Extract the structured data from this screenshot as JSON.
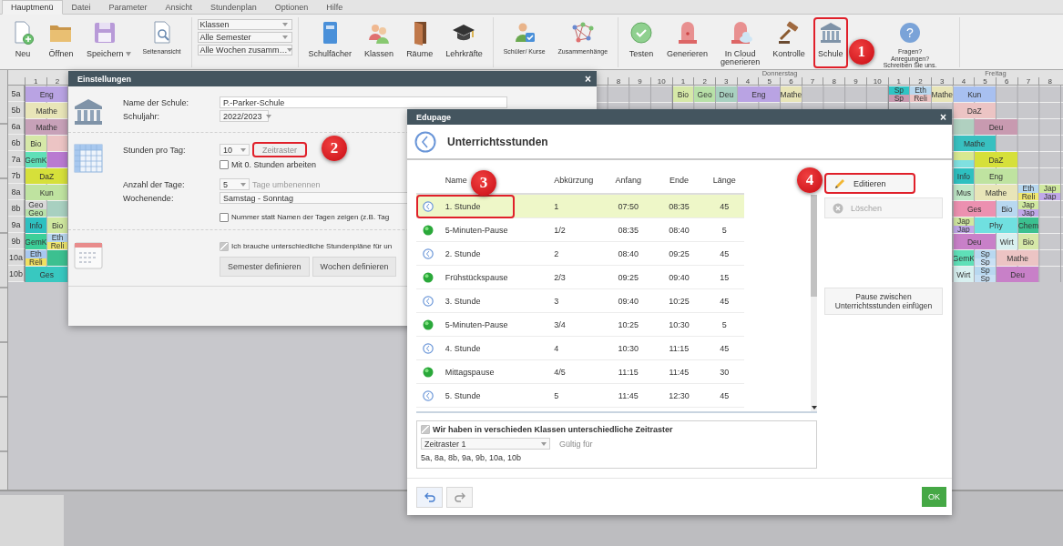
{
  "menu": {
    "tabs": [
      {
        "label": "Hauptmenü",
        "selected": true
      },
      {
        "label": "Datei",
        "selected": false
      },
      {
        "label": "Parameter",
        "selected": false
      },
      {
        "label": "Ansicht",
        "selected": false
      },
      {
        "label": "Stundenplan",
        "selected": false
      },
      {
        "label": "Optionen",
        "selected": false
      },
      {
        "label": "Hilfe",
        "selected": false
      }
    ]
  },
  "toolbar": {
    "groups": [
      {
        "kind": "tools",
        "items": [
          {
            "label": "Neu"
          },
          {
            "label": "Öffnen"
          },
          {
            "label": "Speichern",
            "dropdown": true
          },
          {
            "label": "Seitenansicht",
            "small": true
          }
        ]
      },
      {
        "kind": "selects",
        "items": [
          {
            "value": "Klassen"
          },
          {
            "value": "Alle Semester"
          },
          {
            "value": "Alle Wochen zusamm…"
          }
        ]
      },
      {
        "kind": "tools",
        "items": [
          {
            "label": "Schulfächer"
          },
          {
            "label": "Klassen"
          },
          {
            "label": "Räume"
          },
          {
            "label": "Lehrkräfte"
          }
        ]
      },
      {
        "kind": "tools",
        "items": [
          {
            "label": "Schüler/ Kurse",
            "small": true
          },
          {
            "label": "Zusammenhänge",
            "small": true
          }
        ]
      },
      {
        "kind": "tools",
        "items": [
          {
            "label": "Testen"
          },
          {
            "label": "Generieren"
          },
          {
            "lines": [
              "In Cloud",
              "generieren"
            ]
          },
          {
            "label": "Kontrolle"
          },
          {
            "label": "Schule",
            "marker": "1"
          },
          {
            "glyph": "?",
            "lines": [
              "Fragen?",
              "Anregungen?",
              "Schreiben Sie uns."
            ],
            "small": true
          }
        ]
      }
    ]
  },
  "timetable": {
    "thursday_name": "Donnerstag",
    "friday_name": "Freitag",
    "monday_numbers": [
      "1",
      "2"
    ],
    "wednesday_numbers": [
      "8",
      "9",
      "10"
    ],
    "thursday_numbers": [
      "1",
      "2",
      "3",
      "4",
      "5",
      "6",
      "7",
      "8",
      "9",
      "10"
    ],
    "friday_numbers": [
      "1",
      "2",
      "3",
      "4",
      "5",
      "6",
      "7",
      "8"
    ],
    "rows": [
      {
        "class": "5a",
        "monday": [
          {
            "kind": "double",
            "parts": [
              {
                "label": "Eng",
                "color": "#b9a3e3"
              }
            ]
          }
        ],
        "thursday": [
          {
            "kind": "single",
            "parts": [
              {
                "label": "Bio",
                "color": "#d6e8a8"
              }
            ]
          },
          {
            "kind": "single",
            "parts": [
              {
                "label": "Geo",
                "color": "#b8e0a8"
              }
            ]
          },
          {
            "kind": "single",
            "parts": [
              {
                "label": "Deu",
                "color": "#a8d0c0"
              }
            ]
          },
          {
            "kind": "double",
            "parts": [
              {
                "label": "Eng",
                "color": "#b9a3e3"
              }
            ]
          },
          {
            "kind": "single",
            "parts": [
              {
                "label": "Mathe",
                "color": "#e8e5b8"
              }
            ]
          }
        ],
        "friday": [
          {
            "kind": "single",
            "parts": [
              {
                "label": "Sp",
                "color": "#2ec4c4"
              },
              {
                "label": "Sp",
                "color": "#c89ab0"
              }
            ]
          },
          {
            "kind": "single",
            "parts": [
              {
                "label": "Eth",
                "color": "#b8d8f0"
              },
              {
                "label": "Reli",
                "color": "#ecc4c4"
              }
            ]
          },
          {
            "kind": "single",
            "parts": [
              {
                "label": "Mathe",
                "color": "#e8e5b8"
              }
            ]
          },
          {
            "kind": "double",
            "parts": [
              {
                "label": "Kun",
                "color": "#a8c0f0"
              }
            ]
          }
        ]
      },
      {
        "class": "5b",
        "monday": [
          {
            "kind": "double",
            "parts": [
              {
                "label": "Mathe",
                "color": "#e8e5b8"
              }
            ]
          }
        ],
        "friday_end": [
          {
            "kind": "double",
            "parts": [
              {
                "label": "DaZ",
                "color": "#ecc4c4"
              }
            ]
          }
        ]
      },
      {
        "class": "6a",
        "monday": [
          {
            "kind": "double",
            "parts": [
              {
                "label": "Mathe",
                "color": "#c7a1b8"
              }
            ]
          }
        ],
        "friday_end": [
          {
            "kind": "single",
            "parts": [
              {
                "color": "#b0d0c0"
              }
            ]
          },
          {
            "kind": "double",
            "parts": [
              {
                "label": "Deu",
                "color": "#c89ab0"
              }
            ]
          }
        ]
      },
      {
        "class": "6b",
        "monday": [
          {
            "kind": "single",
            "parts": [
              {
                "label": "Bio",
                "color": "#d6e8a8"
              }
            ]
          },
          {
            "kind": "single",
            "parts": [
              {
                "color": "#ecc4c4"
              }
            ]
          }
        ],
        "friday_end": [
          {
            "kind": "double",
            "parts": [
              {
                "label": "Mathe",
                "color": "#38c0c0"
              }
            ]
          }
        ]
      },
      {
        "class": "7a",
        "monday": [
          {
            "kind": "single",
            "parts": [
              {
                "label": "GemK",
                "color": "#5fe0b8"
              }
            ]
          },
          {
            "kind": "single",
            "parts": [
              {
                "color": "#b97ad1"
              }
            ]
          }
        ],
        "friday_end": [
          {
            "kind": "single",
            "parts": [
              {
                "color": "#d8e890"
              },
              {
                "color": "#80e0e0"
              }
            ]
          },
          {
            "kind": "double",
            "parts": [
              {
                "label": "DaZ",
                "color": "#d6e03a"
              }
            ]
          }
        ]
      },
      {
        "class": "7b",
        "monday": [
          {
            "kind": "double",
            "parts": [
              {
                "label": "DaZ",
                "color": "#d6e03a"
              }
            ]
          }
        ],
        "friday_end": [
          {
            "kind": "single",
            "parts": [
              {
                "label": "Info",
                "color": "#2ec0c0"
              }
            ]
          },
          {
            "kind": "double",
            "parts": [
              {
                "label": "Eng",
                "color": "#bfe3a0"
              }
            ]
          }
        ]
      },
      {
        "class": "8a",
        "monday": [
          {
            "kind": "double",
            "parts": [
              {
                "label": "Kun",
                "color": "#bfe3a0"
              }
            ]
          }
        ],
        "friday_end": [
          {
            "kind": "single",
            "parts": [
              {
                "label": "Mus",
                "color": "#c0e8c8"
              }
            ]
          },
          {
            "kind": "double",
            "parts": [
              {
                "label": "Mathe",
                "color": "#e8e5b8"
              }
            ]
          },
          {
            "kind": "single",
            "parts": [
              {
                "label": "Eth",
                "color": "#b8d8f0"
              },
              {
                "label": "Reli",
                "color": "#f0e870"
              }
            ]
          },
          {
            "kind": "single",
            "parts": [
              {
                "label": "Jap",
                "color": "#d0e8a0"
              },
              {
                "label": "Jap",
                "color": "#c0a8e8"
              }
            ]
          }
        ]
      },
      {
        "class": "8b",
        "monday": [
          {
            "kind": "single",
            "parts": [
              {
                "label": "Geo",
                "color": "#d8d8d8"
              },
              {
                "label": "Geo",
                "color": "#b8e0a8"
              }
            ]
          },
          {
            "kind": "single",
            "parts": [
              {
                "color": "#a8d0c0"
              }
            ]
          }
        ],
        "friday_end": [
          {
            "kind": "double",
            "parts": [
              {
                "label": "Ges",
                "color": "#ec90b0"
              }
            ]
          },
          {
            "kind": "single",
            "parts": [
              {
                "label": "Bio",
                "color": "#b8d8f0"
              }
            ]
          },
          {
            "kind": "single",
            "parts": [
              {
                "label": "Jap",
                "color": "#d0e8a0"
              },
              {
                "label": "Jap",
                "color": "#c0a8e8"
              }
            ]
          }
        ]
      },
      {
        "class": "9a",
        "monday": [
          {
            "kind": "single",
            "parts": [
              {
                "label": "Info",
                "color": "#2ec0c0"
              }
            ]
          },
          {
            "kind": "single",
            "parts": [
              {
                "label": "Bio",
                "color": "#d0e8a0"
              }
            ]
          }
        ],
        "friday_end": [
          {
            "kind": "single",
            "parts": [
              {
                "label": "Jap",
                "color": "#d0e8a0"
              },
              {
                "label": "Jap",
                "color": "#c0a8e8"
              }
            ]
          },
          {
            "kind": "double",
            "parts": [
              {
                "label": "Phy",
                "color": "#70e0e0"
              }
            ]
          },
          {
            "kind": "single",
            "parts": [
              {
                "label": "Chem",
                "color": "#3cc090"
              }
            ]
          }
        ]
      },
      {
        "class": "9b",
        "monday": [
          {
            "kind": "single",
            "parts": [
              {
                "label": "GemK",
                "color": "#3ccf98"
              }
            ]
          },
          {
            "kind": "single",
            "parts": [
              {
                "label": "Eth",
                "color": "#b8d8f0"
              },
              {
                "label": "Reli",
                "color": "#f0e870"
              }
            ]
          }
        ],
        "friday_end": [
          {
            "kind": "double",
            "parts": [
              {
                "label": "Deu",
                "color": "#c880c8"
              }
            ]
          },
          {
            "kind": "single",
            "parts": [
              {
                "label": "Wirt",
                "color": "#d8f0f0"
              }
            ]
          },
          {
            "kind": "single",
            "parts": [
              {
                "label": "Bio",
                "color": "#d6e8a8"
              }
            ]
          }
        ]
      },
      {
        "class": "10a",
        "monday": [
          {
            "kind": "single",
            "parts": [
              {
                "label": "Eth",
                "color": "#a8c8f0"
              },
              {
                "label": "Reli",
                "color": "#f0e060"
              }
            ]
          },
          {
            "kind": "single",
            "parts": [
              {
                "color": "#3cc090"
              }
            ]
          }
        ],
        "friday_end": [
          {
            "kind": "single",
            "parts": [
              {
                "label": "GemK",
                "color": "#5fe0b8"
              }
            ]
          },
          {
            "kind": "single",
            "parts": [
              {
                "label": "Sp",
                "color": "#b8d8f0"
              },
              {
                "label": "Sp",
                "color": "#c8e0f4"
              }
            ]
          },
          {
            "kind": "double",
            "parts": [
              {
                "label": "Mathe",
                "color": "#ecc4c4"
              }
            ]
          }
        ]
      },
      {
        "class": "10b",
        "monday": [
          {
            "kind": "double",
            "parts": [
              {
                "label": "Ges",
                "color": "#38c8c0"
              }
            ]
          }
        ],
        "friday_end": [
          {
            "kind": "single",
            "parts": [
              {
                "label": "Wirt",
                "color": "#d8f0f0"
              }
            ]
          },
          {
            "kind": "single",
            "parts": [
              {
                "label": "Sp",
                "color": "#b8d8f0"
              },
              {
                "label": "Sp",
                "color": "#c8e0f4"
              }
            ]
          },
          {
            "kind": "double",
            "parts": [
              {
                "label": "Deu",
                "color": "#c880c8"
              }
            ]
          }
        ]
      }
    ]
  },
  "settings_dialog": {
    "title": "Einstellungen",
    "close": "×",
    "school": {
      "name_label": "Name der Schule:",
      "name": "P.-Parker-Schule",
      "year_label": "Schuljahr:",
      "year": "2022/2023"
    },
    "periods": {
      "label": "Stunden pro Tag:",
      "value": "10",
      "button": {
        "label": "Zeitraster",
        "marker": "2"
      },
      "zero_checkbox": {
        "label": "Mit 0. Stunden arbeiten",
        "checked": false
      }
    },
    "days": {
      "label": "Anzahl der Tage:",
      "value": "5",
      "rename_link": "Tage umbenennen",
      "weekend_label": "Wochenende:",
      "weekend": "Samstag - Sonntag",
      "number_checkbox": {
        "label": "Nummer statt Namen der Tagen zeigen (z.B. Tag",
        "checked": false
      }
    },
    "terms": {
      "checkbox": {
        "label": "Ich brauche unterschiedliche Stundenpläne für un",
        "checked": true
      },
      "buttons": [
        "Semester definieren",
        "Wochen definieren"
      ]
    }
  },
  "lessons_dialog": {
    "title": "Edupage",
    "close": "×",
    "heading": "Unterrichtsstunden",
    "columns": [
      "Name",
      "Abkürzung",
      "Anfang",
      "Ende",
      "Länge"
    ],
    "rows": [
      {
        "kind": "lesson",
        "name": "1. Stunde",
        "abbr": "1",
        "start": "07:50",
        "end": "08:35",
        "length": "45",
        "selected": true,
        "marker": "3"
      },
      {
        "kind": "break",
        "name": "5-Minuten-Pause",
        "abbr": "1/2",
        "start": "08:35",
        "end": "08:40",
        "length": "5",
        "selected": false
      },
      {
        "kind": "lesson",
        "name": "2. Stunde",
        "abbr": "2",
        "start": "08:40",
        "end": "09:25",
        "length": "45",
        "selected": false
      },
      {
        "kind": "break",
        "name": "Frühstückspause",
        "abbr": "2/3",
        "start": "09:25",
        "end": "09:40",
        "length": "15",
        "selected": false
      },
      {
        "kind": "lesson",
        "name": "3. Stunde",
        "abbr": "3",
        "start": "09:40",
        "end": "10:25",
        "length": "45",
        "selected": false
      },
      {
        "kind": "break",
        "name": "5-Minuten-Pause",
        "abbr": "3/4",
        "start": "10:25",
        "end": "10:30",
        "length": "5",
        "selected": false
      },
      {
        "kind": "lesson",
        "name": "4. Stunde",
        "abbr": "4",
        "start": "10:30",
        "end": "11:15",
        "length": "45",
        "selected": false
      },
      {
        "kind": "break",
        "name": "Mittagspause",
        "abbr": "4/5",
        "start": "11:15",
        "end": "11:45",
        "length": "30",
        "selected": false
      },
      {
        "kind": "lesson",
        "name": "5. Stunde",
        "abbr": "5",
        "start": "11:45",
        "end": "12:30",
        "length": "45",
        "selected": false
      }
    ],
    "actions": [
      {
        "kind": "edit",
        "label": "Editieren",
        "disabled": false,
        "marker": "4"
      },
      {
        "kind": "delete",
        "label": "Löschen",
        "disabled": true
      },
      {
        "kind": "insert",
        "label": "Pause zwischen Unterrichtsstunden einfügen",
        "disabled": false
      }
    ],
    "grids": {
      "checkbox": {
        "label": "Wir haben in verschieden Klassen unterschiedliche Zeitraster",
        "checked": true
      },
      "select": "Zeitraster 1",
      "valid_label": "Gültig für",
      "classes": "5a, 8a, 8b, 9a, 9b, 10a, 10b"
    },
    "ok": "OK"
  }
}
